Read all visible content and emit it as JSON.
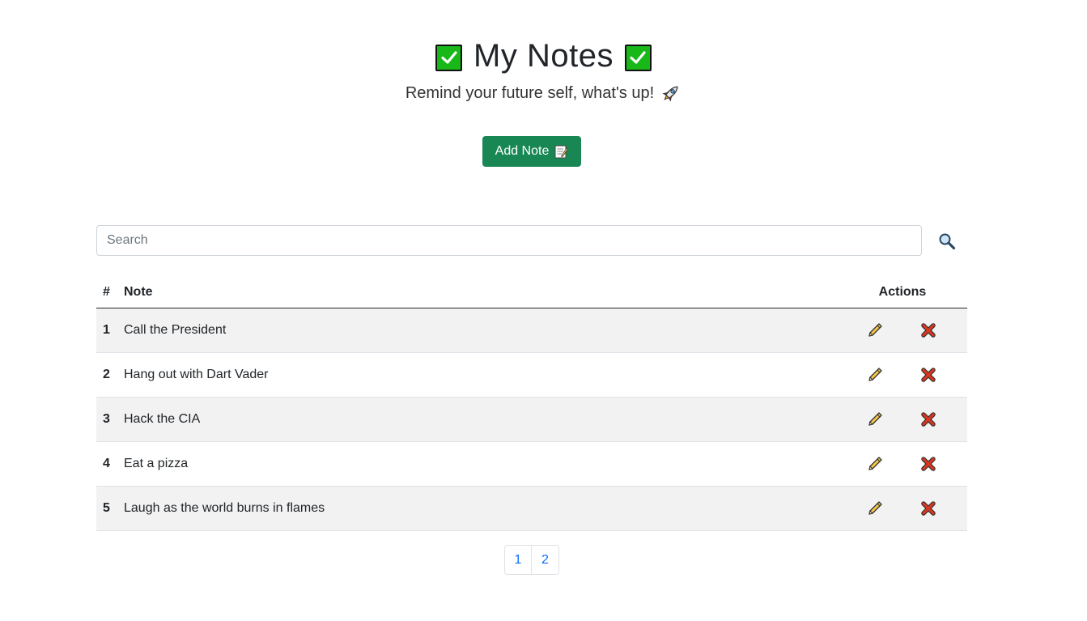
{
  "header": {
    "title": "My Notes",
    "subtitle": "Remind your future self, what's up!",
    "title_icon": "check-mark-button-icon",
    "subtitle_icon": "rocket-icon"
  },
  "toolbar": {
    "add_label": "Add Note",
    "add_icon": "memo-icon"
  },
  "search": {
    "placeholder": "Search",
    "value": "",
    "button_icon": "magnifying-glass-icon"
  },
  "table": {
    "headers": {
      "num": "#",
      "note": "Note",
      "actions": "Actions"
    },
    "rows": [
      {
        "num": "1",
        "note": "Call the President"
      },
      {
        "num": "2",
        "note": "Hang out with Dart Vader"
      },
      {
        "num": "3",
        "note": "Hack the CIA"
      },
      {
        "num": "4",
        "note": "Eat a pizza"
      },
      {
        "num": "5",
        "note": "Laugh as the world burns in flames"
      }
    ],
    "row_actions": {
      "edit_icon": "pencil-icon",
      "delete_icon": "cross-mark-icon"
    }
  },
  "pagination": {
    "pages": [
      "1",
      "2"
    ],
    "current": "1"
  },
  "colors": {
    "add_button": "#198754",
    "link": "#0d6efd",
    "check_green": "#18b818",
    "delete_red": "#d9361f",
    "pencil_yellow": "#f7c948",
    "striped_row": "#f2f2f2"
  }
}
